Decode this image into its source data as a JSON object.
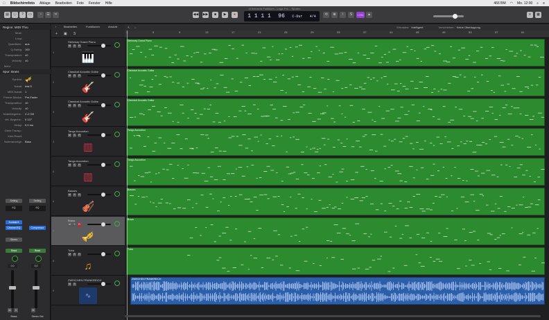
{
  "menubar": {
    "app": "Bildschirmfoto",
    "items": [
      "Ablage",
      "Bearbeiten",
      "Foto",
      "Fenster",
      "Hilfe"
    ],
    "battery": "466 BM",
    "clock": "Mo. 12:00"
  },
  "window_title": "Unbenannt Publikum - Logic Pro – Spuren",
  "lcd": {
    "position": "1  1  1   1",
    "tempo": "96",
    "key": "C-Dur",
    "signature": "4/4"
  },
  "cpu_label": "1234",
  "inspector": {
    "region_header": "Region: MIDI Thru",
    "rows": [
      {
        "k": "Mute:",
        "v": ""
      },
      {
        "k": "Loop:",
        "v": ""
      },
      {
        "k": "Quantisier.:",
        "v": "aus"
      },
      {
        "k": "Q-Swing:",
        "v": "100"
      },
      {
        "k": "Transposition:",
        "v": "±0"
      },
      {
        "k": "Velocity:",
        "v": "±0"
      },
      {
        "k": "Mehr",
        "v": ""
      }
    ],
    "track_header": "Spur: Brass",
    "track_rows": [
      {
        "k": "Symbol:",
        "v": ""
      },
      {
        "k": "Kanal:",
        "v": "Inst 5"
      },
      {
        "k": "MIDI-Kanal:",
        "v": "1"
      },
      {
        "k": "Freeze-Modus:",
        "v": "Pre-Fader"
      },
      {
        "k": "Transposition:",
        "v": "±0"
      },
      {
        "k": "Velocity:",
        "v": "±0"
      },
      {
        "k": "Notenbegrenz.:",
        "v": "C-2   G8"
      },
      {
        "k": "Vel.-Begrenz.:",
        "v": "0   127"
      },
      {
        "k": "Delay:",
        "v": "0,0 ms"
      },
      {
        "k": "Ohne Transp.:",
        "v": ""
      },
      {
        "k": "Kein Reset:",
        "v": ""
      },
      {
        "k": "Notenanzeige:",
        "v": "Bass"
      }
    ],
    "strips": [
      {
        "setting": "Setting",
        "eq": "EQ",
        "input": "Kontakt 5",
        "fx": "Channel EQ",
        "send": "Stereo",
        "output": "Read",
        "vol": "0,0",
        "name": "Brass",
        "mute": "M",
        "solo": "S"
      },
      {
        "setting": "Setting",
        "eq": "EQ",
        "input": "",
        "fx": "Compressor",
        "send": "",
        "output": "Read",
        "vol": "0,0",
        "name": "Stereo Out",
        "mute": "M",
        "solo": ""
      }
    ]
  },
  "tracks_toolbar": {
    "edit": "Bearbeiten",
    "functions": "Funktionen",
    "view": "Ansicht"
  },
  "ruler_bar": {
    "snap_label": "Einrasten:",
    "snap_value": "Intelligent",
    "drag_label": "Verschieben:",
    "drag_value": "Keine Überlappung"
  },
  "ruler_ticks": [
    "1",
    "5",
    "9",
    "13",
    "17",
    "21",
    "25",
    "29",
    "33",
    "37",
    "41",
    "45",
    "49",
    "53",
    "57",
    "61"
  ],
  "tracks": [
    {
      "num": "1",
      "name": "Steinway Grand Piano",
      "icon": "piano-icon",
      "region": "Steinway Grand Piano",
      "type": "midi"
    },
    {
      "num": "2",
      "name": "Classical Acoustic Guitar",
      "icon": "guitar-icon",
      "region": "Classical Acoustic Guitar",
      "type": "midi"
    },
    {
      "num": "3",
      "name": "Classical Acoustic Guitar",
      "icon": "guitar-icon",
      "region": "Classical Acoustic Guitar",
      "type": "midi"
    },
    {
      "num": "4",
      "name": "Tango Accordion",
      "icon": "accordion-icon",
      "region": "Tango Accordion",
      "type": "midi"
    },
    {
      "num": "5",
      "name": "Tango Accordion",
      "icon": "accordion-icon",
      "region": "Tango Accordion",
      "type": "midi"
    },
    {
      "num": "6",
      "name": "Basses",
      "icon": "bass-icon",
      "region": "Basses",
      "type": "midi"
    },
    {
      "num": "7",
      "name": "Brass",
      "icon": "horn-icon",
      "region": "Brass",
      "type": "midi"
    },
    {
      "num": "8",
      "name": "Tuba",
      "icon": "tuba-icon",
      "region": "Tuba",
      "type": "midi"
    },
    {
      "num": "9",
      "name": "ZWISCHEN FRANKREICH",
      "icon": "waveform-icon",
      "region": "ZWISCHEN FRANKREICH",
      "type": "audio"
    }
  ],
  "colors": {
    "midi_region": "#2d8b2f",
    "audio_region": "#2c5fa8",
    "accent": "#2a6fd6"
  }
}
